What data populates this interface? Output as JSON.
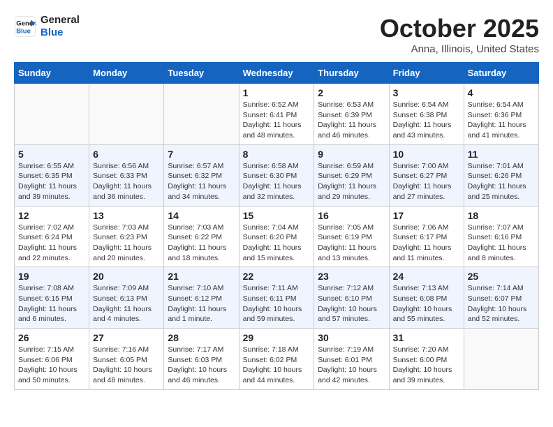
{
  "logo": {
    "line1": "General",
    "line2": "Blue"
  },
  "title": "October 2025",
  "location": "Anna, Illinois, United States",
  "days_header": [
    "Sunday",
    "Monday",
    "Tuesday",
    "Wednesday",
    "Thursday",
    "Friday",
    "Saturday"
  ],
  "weeks": [
    [
      {
        "day": "",
        "info": ""
      },
      {
        "day": "",
        "info": ""
      },
      {
        "day": "",
        "info": ""
      },
      {
        "day": "1",
        "info": "Sunrise: 6:52 AM\nSunset: 6:41 PM\nDaylight: 11 hours\nand 48 minutes."
      },
      {
        "day": "2",
        "info": "Sunrise: 6:53 AM\nSunset: 6:39 PM\nDaylight: 11 hours\nand 46 minutes."
      },
      {
        "day": "3",
        "info": "Sunrise: 6:54 AM\nSunset: 6:38 PM\nDaylight: 11 hours\nand 43 minutes."
      },
      {
        "day": "4",
        "info": "Sunrise: 6:54 AM\nSunset: 6:36 PM\nDaylight: 11 hours\nand 41 minutes."
      }
    ],
    [
      {
        "day": "5",
        "info": "Sunrise: 6:55 AM\nSunset: 6:35 PM\nDaylight: 11 hours\nand 39 minutes."
      },
      {
        "day": "6",
        "info": "Sunrise: 6:56 AM\nSunset: 6:33 PM\nDaylight: 11 hours\nand 36 minutes."
      },
      {
        "day": "7",
        "info": "Sunrise: 6:57 AM\nSunset: 6:32 PM\nDaylight: 11 hours\nand 34 minutes."
      },
      {
        "day": "8",
        "info": "Sunrise: 6:58 AM\nSunset: 6:30 PM\nDaylight: 11 hours\nand 32 minutes."
      },
      {
        "day": "9",
        "info": "Sunrise: 6:59 AM\nSunset: 6:29 PM\nDaylight: 11 hours\nand 29 minutes."
      },
      {
        "day": "10",
        "info": "Sunrise: 7:00 AM\nSunset: 6:27 PM\nDaylight: 11 hours\nand 27 minutes."
      },
      {
        "day": "11",
        "info": "Sunrise: 7:01 AM\nSunset: 6:26 PM\nDaylight: 11 hours\nand 25 minutes."
      }
    ],
    [
      {
        "day": "12",
        "info": "Sunrise: 7:02 AM\nSunset: 6:24 PM\nDaylight: 11 hours\nand 22 minutes."
      },
      {
        "day": "13",
        "info": "Sunrise: 7:03 AM\nSunset: 6:23 PM\nDaylight: 11 hours\nand 20 minutes."
      },
      {
        "day": "14",
        "info": "Sunrise: 7:03 AM\nSunset: 6:22 PM\nDaylight: 11 hours\nand 18 minutes."
      },
      {
        "day": "15",
        "info": "Sunrise: 7:04 AM\nSunset: 6:20 PM\nDaylight: 11 hours\nand 15 minutes."
      },
      {
        "day": "16",
        "info": "Sunrise: 7:05 AM\nSunset: 6:19 PM\nDaylight: 11 hours\nand 13 minutes."
      },
      {
        "day": "17",
        "info": "Sunrise: 7:06 AM\nSunset: 6:17 PM\nDaylight: 11 hours\nand 11 minutes."
      },
      {
        "day": "18",
        "info": "Sunrise: 7:07 AM\nSunset: 6:16 PM\nDaylight: 11 hours\nand 8 minutes."
      }
    ],
    [
      {
        "day": "19",
        "info": "Sunrise: 7:08 AM\nSunset: 6:15 PM\nDaylight: 11 hours\nand 6 minutes."
      },
      {
        "day": "20",
        "info": "Sunrise: 7:09 AM\nSunset: 6:13 PM\nDaylight: 11 hours\nand 4 minutes."
      },
      {
        "day": "21",
        "info": "Sunrise: 7:10 AM\nSunset: 6:12 PM\nDaylight: 11 hours\nand 1 minute."
      },
      {
        "day": "22",
        "info": "Sunrise: 7:11 AM\nSunset: 6:11 PM\nDaylight: 10 hours\nand 59 minutes."
      },
      {
        "day": "23",
        "info": "Sunrise: 7:12 AM\nSunset: 6:10 PM\nDaylight: 10 hours\nand 57 minutes."
      },
      {
        "day": "24",
        "info": "Sunrise: 7:13 AM\nSunset: 6:08 PM\nDaylight: 10 hours\nand 55 minutes."
      },
      {
        "day": "25",
        "info": "Sunrise: 7:14 AM\nSunset: 6:07 PM\nDaylight: 10 hours\nand 52 minutes."
      }
    ],
    [
      {
        "day": "26",
        "info": "Sunrise: 7:15 AM\nSunset: 6:06 PM\nDaylight: 10 hours\nand 50 minutes."
      },
      {
        "day": "27",
        "info": "Sunrise: 7:16 AM\nSunset: 6:05 PM\nDaylight: 10 hours\nand 48 minutes."
      },
      {
        "day": "28",
        "info": "Sunrise: 7:17 AM\nSunset: 6:03 PM\nDaylight: 10 hours\nand 46 minutes."
      },
      {
        "day": "29",
        "info": "Sunrise: 7:18 AM\nSunset: 6:02 PM\nDaylight: 10 hours\nand 44 minutes."
      },
      {
        "day": "30",
        "info": "Sunrise: 7:19 AM\nSunset: 6:01 PM\nDaylight: 10 hours\nand 42 minutes."
      },
      {
        "day": "31",
        "info": "Sunrise: 7:20 AM\nSunset: 6:00 PM\nDaylight: 10 hours\nand 39 minutes."
      },
      {
        "day": "",
        "info": ""
      }
    ]
  ]
}
